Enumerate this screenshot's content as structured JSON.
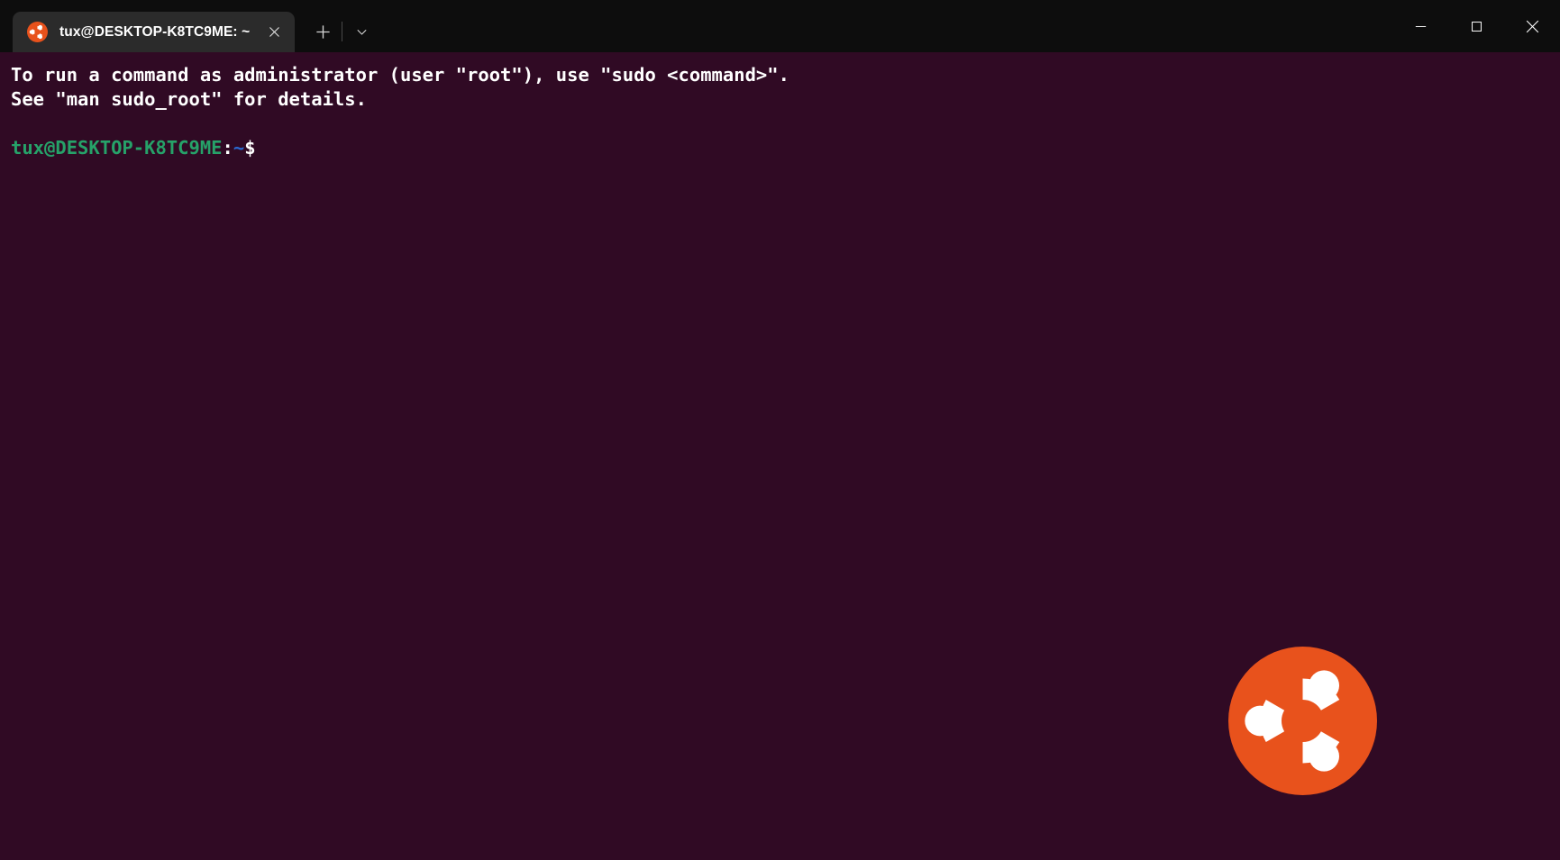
{
  "window": {
    "app": "Windows Terminal",
    "titlebar_bg": "#0d0d0d",
    "tab_bg": "#2b2b2b"
  },
  "tab": {
    "icon": "ubuntu-icon",
    "title": "tux@DESKTOP-K8TC9ME: ~",
    "close_label": "✕"
  },
  "tabbar": {
    "new_tab_label": "+",
    "dropdown_label": "⌄"
  },
  "window_controls": {
    "minimize_label": "─",
    "maximize_label": "□",
    "close_label": "✕"
  },
  "terminal": {
    "background": "#300a24",
    "foreground": "#ffffff",
    "prompt_user_color": "#26a269",
    "prompt_path_color": "#2a6bd4",
    "lines": [
      "To run a command as administrator (user \"root\"), use \"sudo <command>\".",
      "See \"man sudo_root\" for details."
    ],
    "prompt": {
      "user_host": "tux@DESKTOP-K8TC9ME",
      "separator": ":",
      "path": "~",
      "sigil": "$"
    }
  },
  "watermark": {
    "name": "ubuntu-logo",
    "color": "#e8521c"
  }
}
